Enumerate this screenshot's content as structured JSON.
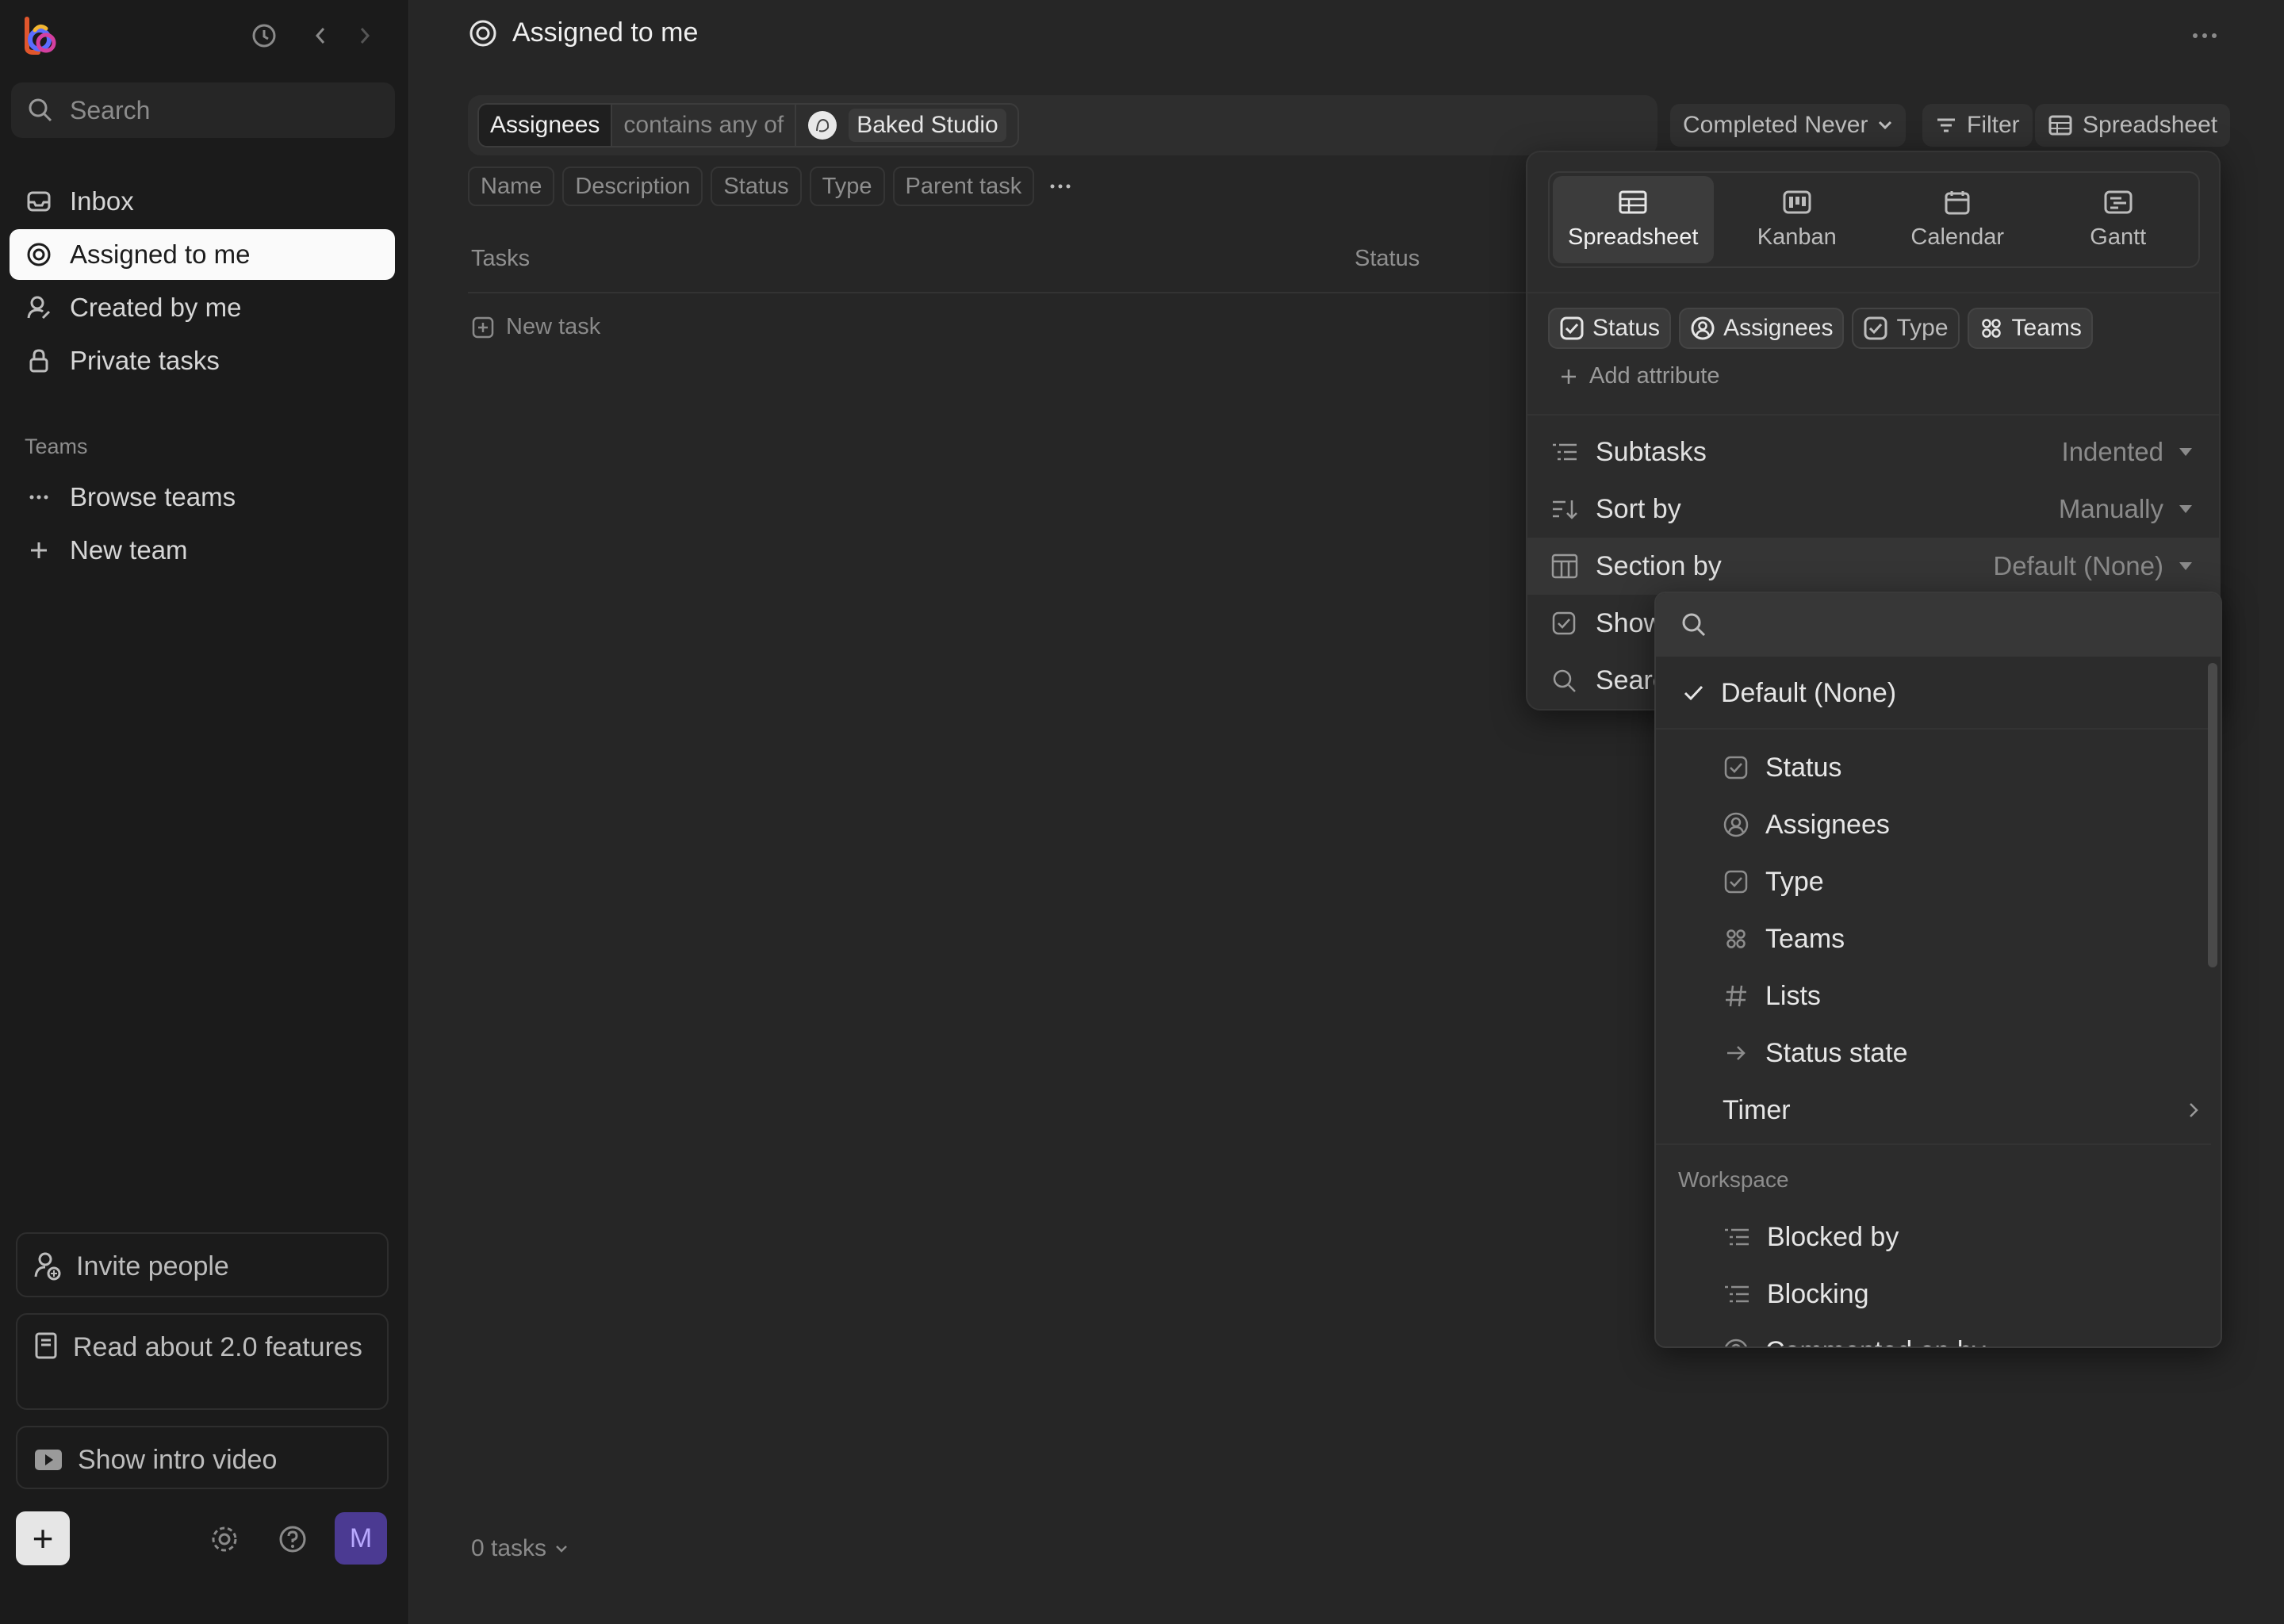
{
  "sidebar": {
    "search_placeholder": "Search",
    "nav": [
      {
        "label": "Inbox"
      },
      {
        "label": "Assigned to me"
      },
      {
        "label": "Created by me"
      },
      {
        "label": "Private tasks"
      }
    ],
    "teams_label": "Teams",
    "teams": [
      {
        "label": "Browse teams"
      },
      {
        "label": "New team"
      }
    ],
    "invite_label": "Invite people",
    "read_label": "Read about 2.0 features",
    "intro_label": "Show intro video",
    "avatar_initial": "M"
  },
  "header": {
    "title": "Assigned to me"
  },
  "filter": {
    "field": "Assignees",
    "operator": "contains any of",
    "value": "Baked Studio",
    "completed": "Completed Never",
    "filter_label": "Filter",
    "view_label": "Spreadsheet"
  },
  "columns": [
    "Name",
    "Description",
    "Status",
    "Type",
    "Parent task"
  ],
  "table": {
    "col_tasks": "Tasks",
    "col_status": "Status",
    "new_task": "New task",
    "count": "0 tasks"
  },
  "view_panel": {
    "tabs": [
      {
        "label": "Spreadsheet",
        "icon": "table-icon"
      },
      {
        "label": "Kanban",
        "icon": "kanban-icon"
      },
      {
        "label": "Calendar",
        "icon": "calendar-icon"
      },
      {
        "label": "Gantt",
        "icon": "gantt-icon"
      }
    ],
    "attributes": [
      "Status",
      "Assignees",
      "Type",
      "Teams"
    ],
    "add_attribute": "Add attribute",
    "subtasks_label": "Subtasks",
    "subtasks_value": "Indented",
    "sort_label": "Sort by",
    "sort_value": "Manually",
    "section_label": "Section by",
    "section_value": "Default (None)",
    "show_label": "Show",
    "search_label": "Searc"
  },
  "dropdown": {
    "selected": "Default (None)",
    "items": [
      {
        "label": "Status",
        "icon": "checkbox-icon"
      },
      {
        "label": "Assignees",
        "icon": "person-icon"
      },
      {
        "label": "Type",
        "icon": "checkbox-icon"
      },
      {
        "label": "Teams",
        "icon": "grid-icon"
      },
      {
        "label": "Lists",
        "icon": "hash-icon"
      },
      {
        "label": "Status state",
        "icon": "arrow-right-icon"
      }
    ],
    "timer_label": "Timer",
    "workspace_label": "Workspace",
    "workspace_items": [
      {
        "label": "Blocked by"
      },
      {
        "label": "Blocking"
      },
      {
        "label": "Commented on by"
      }
    ]
  },
  "colors": {
    "sidebar_bg": "#1b1b1b",
    "main_bg": "#262626",
    "avatar_bg": "#4b3a92"
  }
}
